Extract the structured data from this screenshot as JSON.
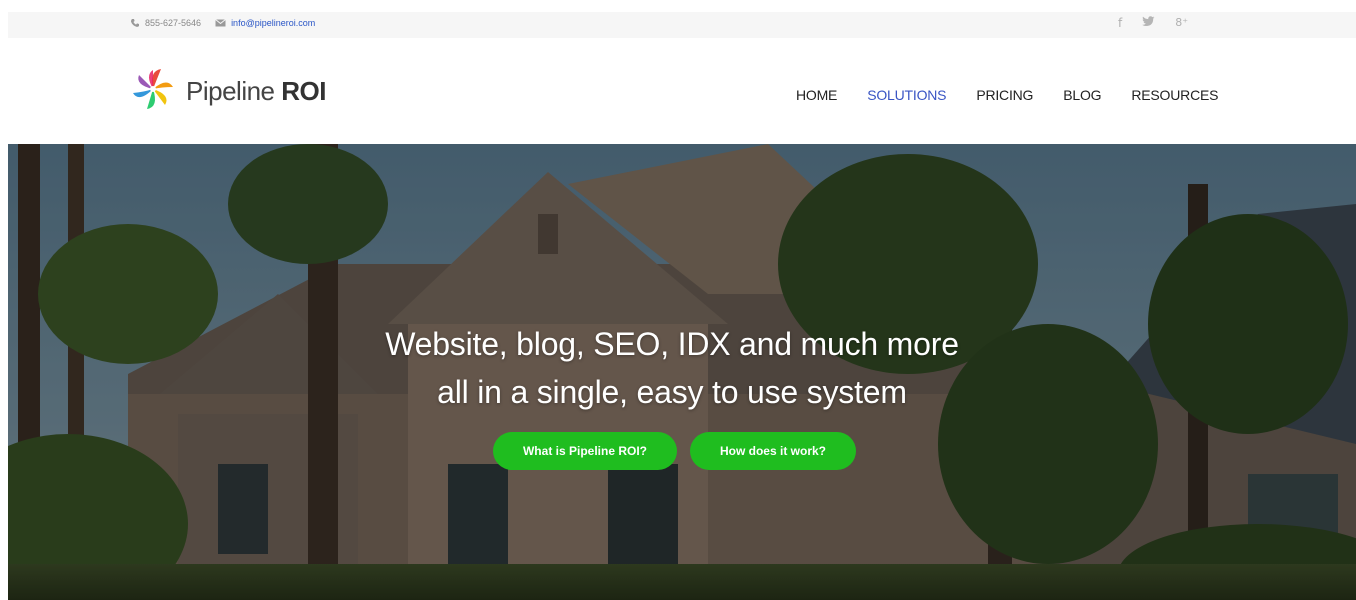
{
  "topbar": {
    "phone": "855-627-5646",
    "email": "info@pipelineroi.com",
    "social": [
      {
        "name": "facebook",
        "glyph": "f"
      },
      {
        "name": "twitter",
        "glyph": "❦"
      },
      {
        "name": "google-plus",
        "glyph": "8⁺"
      }
    ]
  },
  "header": {
    "logo_text_light": "Pipeline",
    "logo_text_bold": "ROI",
    "nav": [
      {
        "label": "HOME",
        "active": false
      },
      {
        "label": "SOLUTIONS",
        "active": true
      },
      {
        "label": "PRICING",
        "active": false
      },
      {
        "label": "BLOG",
        "active": false
      },
      {
        "label": "RESOURCES",
        "active": false
      }
    ]
  },
  "hero": {
    "title_line1": "Website, blog, SEO, IDX and much more",
    "title_line2": "all in a single, easy to use system",
    "button_primary": "What is Pipeline ROI?",
    "button_secondary": "How does it work?"
  },
  "colors": {
    "accent_green": "#1fbd1f",
    "nav_active": "#3a55c4",
    "email_link": "#2a56c6"
  }
}
